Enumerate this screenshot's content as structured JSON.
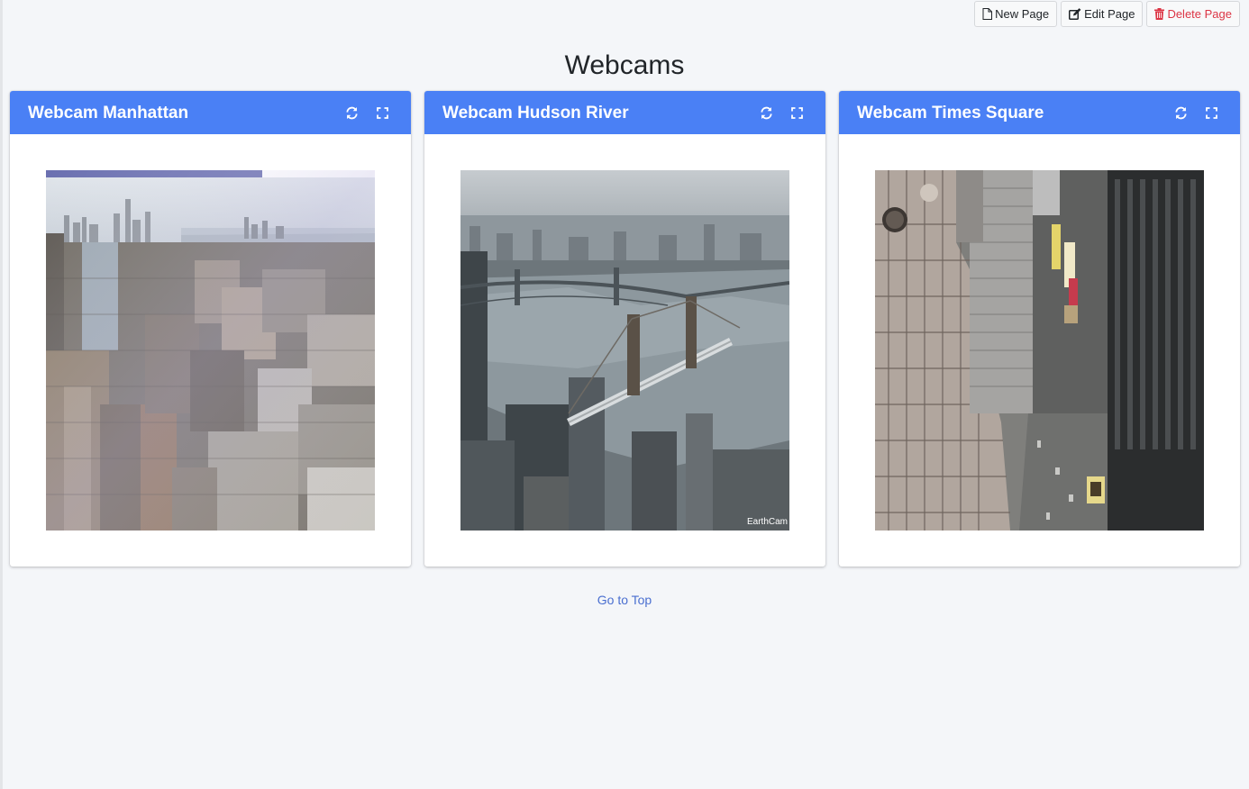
{
  "toolbar": {
    "new_page": "New Page",
    "edit_page": "Edit Page",
    "delete_page": "Delete Page"
  },
  "page": {
    "title": "Webcams",
    "goto_top": "Go to Top"
  },
  "webcams": [
    {
      "title": "Webcam Manhattan"
    },
    {
      "title": "Webcam Hudson River",
      "watermark": "EarthCam"
    },
    {
      "title": "Webcam Times Square"
    }
  ],
  "colors": {
    "card_header": "#4a80f5",
    "danger": "#dc3545",
    "link": "#4a6fd0",
    "background": "#f4f6f9"
  },
  "icons": {
    "refresh": "refresh-icon",
    "expand": "expand-icon",
    "new_page": "file-icon",
    "edit_page": "edit-icon",
    "delete_page": "trash-icon"
  }
}
